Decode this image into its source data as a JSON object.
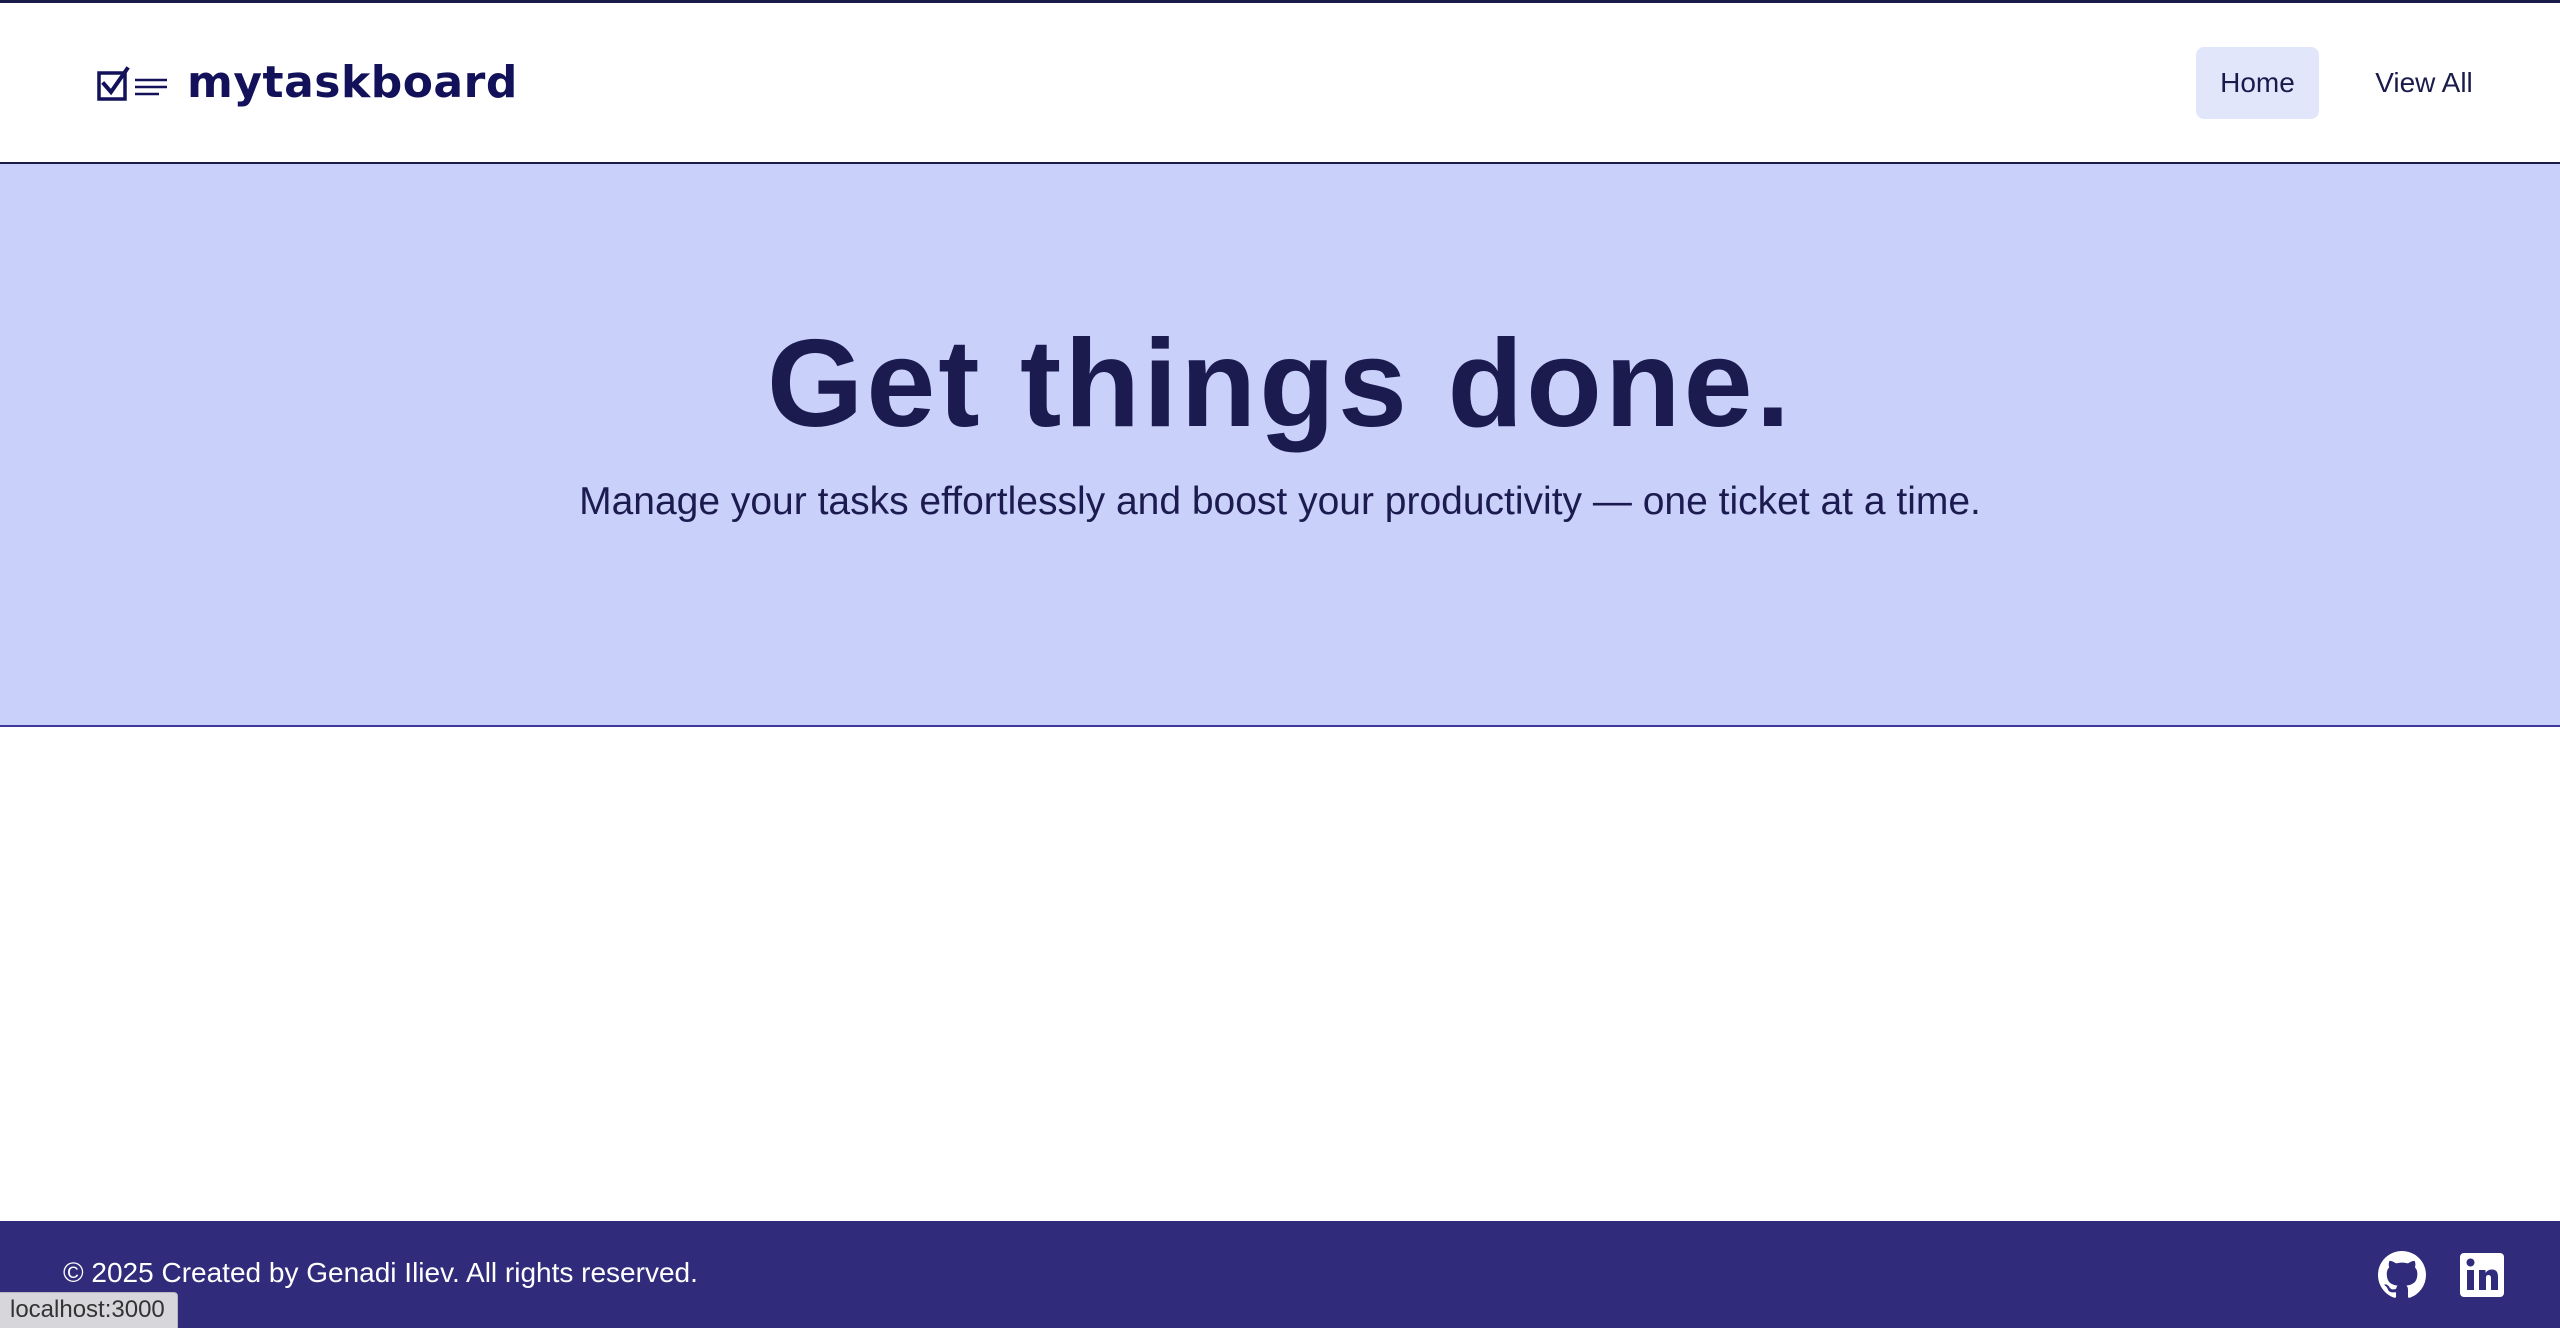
{
  "header": {
    "logo_text": "mytaskboard",
    "logo_icon": "checkbox-list-icon",
    "nav": {
      "home_label": "Home",
      "view_all_label": "View All"
    }
  },
  "hero": {
    "title": "Get things done.",
    "subtitle": "Manage your tasks effortlessly and boost your productivity — one ticket at a time."
  },
  "footer": {
    "copyright": "© 2025 Created by Genadi Iliev. All rights reserved.",
    "icons": [
      "github-icon",
      "linkedin-icon"
    ]
  },
  "statusbar": {
    "url": "localhost:3000"
  },
  "colors": {
    "primary_dark": "#1a1b4b",
    "logo_text": "#12115a",
    "hero_bg": "#c9d1fb",
    "nav_active_bg": "#e2e6fb",
    "footer_bg": "#302b7a"
  }
}
